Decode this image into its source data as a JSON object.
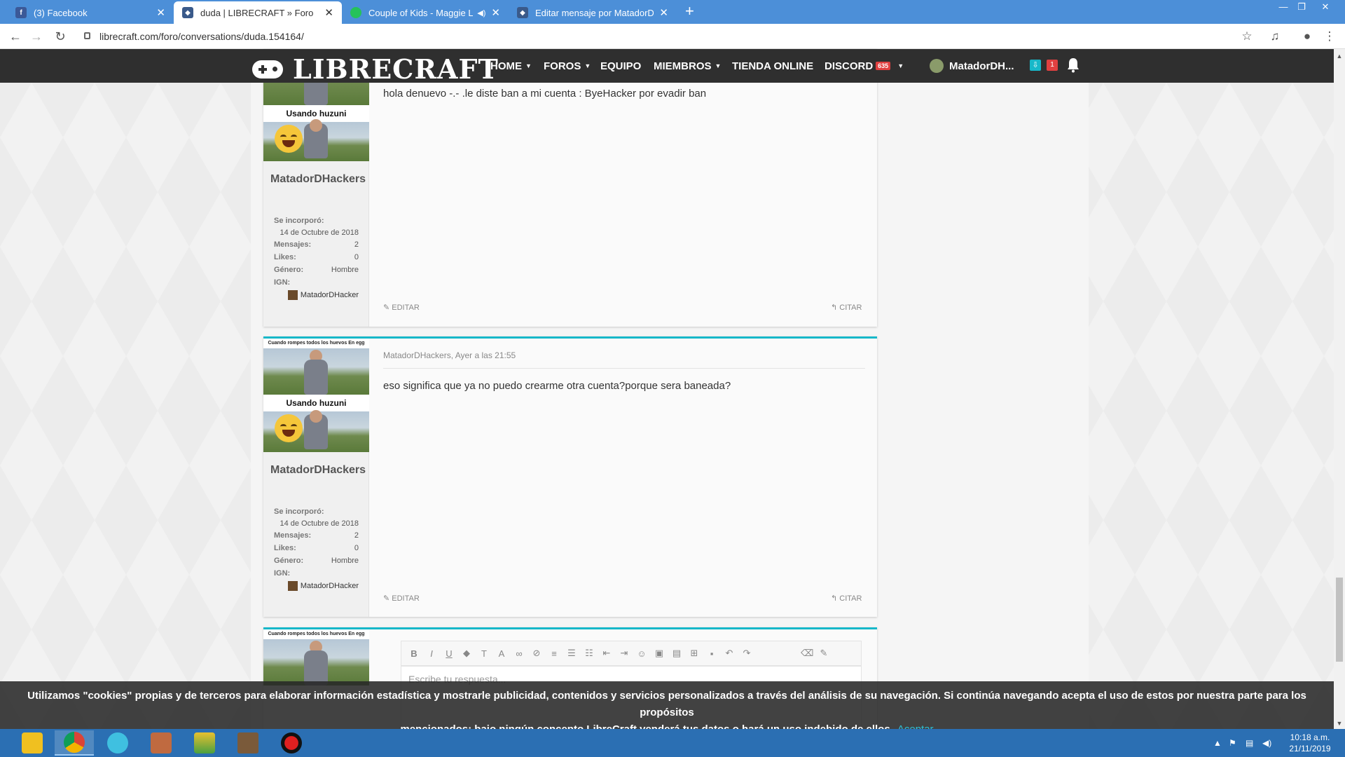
{
  "browser": {
    "tabs": [
      {
        "title": "(3) Facebook",
        "favicon": "facebook-icon",
        "active": false
      },
      {
        "title": "duda | LIBRECRAFT » Foro",
        "favicon": "librecraft-icon",
        "active": true
      },
      {
        "title": "Couple of Kids - Maggie Lind",
        "favicon": "music-icon",
        "active": false,
        "audio": true
      },
      {
        "title": "Editar mensaje por MatadorDHa",
        "favicon": "librecraft-icon",
        "active": false
      }
    ],
    "url": "librecraft.com/foro/conversations/duda.154164/"
  },
  "site": {
    "logo_text": "LIBRECRAFT",
    "nav": {
      "home": "HOME",
      "foros": "FOROS",
      "equipo": "EQUIPO",
      "miembros": "MIEMBROS",
      "tienda": "TIENDA ONLINE",
      "discord": "DISCORD",
      "discord_count": "635"
    },
    "user": {
      "name": "MatadorDH...",
      "alerts": "1"
    }
  },
  "posts": [
    {
      "avatar_caption_top": "Usando huzuni",
      "username": "MatadorDHackers",
      "joined_label": "Se incorporó:",
      "joined": "14 de Octubre de 2018",
      "messages_label": "Mensajes:",
      "messages": "2",
      "likes_label": "Likes:",
      "likes": "0",
      "gender_label": "Género:",
      "gender": "Hombre",
      "ign_label": "IGN:",
      "ign": "MatadorDHacker",
      "body": "hola denuevo -.- .le diste ban a mi cuenta : ByeHacker por evadir ban",
      "edit": "EDITAR",
      "quote": "CITAR"
    },
    {
      "avatar_caption_top": "Cuando rompes todos los huevos En egg wars",
      "avatar_caption_mid": "Usando huzuni",
      "username": "MatadorDHackers",
      "meta": "MatadorDHackers, Ayer a las 21:55",
      "joined_label": "Se incorporó:",
      "joined": "14 de Octubre de 2018",
      "messages_label": "Mensajes:",
      "messages": "2",
      "likes_label": "Likes:",
      "likes": "0",
      "gender_label": "Género:",
      "gender": "Hombre",
      "ign_label": "IGN:",
      "ign": "MatadorDHacker",
      "body": "eso significa que ya no puedo crearme otra cuenta?porque sera baneada?",
      "edit": "EDITAR",
      "quote": "CITAR"
    }
  ],
  "reply": {
    "avatar_caption_top": "Cuando rompes todos los huevos En egg wars",
    "placeholder": "Escribe tu respuesta..."
  },
  "cookie": {
    "text_line1": "Utilizamos \"cookies\" propias y de terceros para elaborar información estadística y mostrarle publicidad, contenidos y servicios personalizados a través del análisis de su navegación. Si continúa navegando acepta el uso de estos por nuestra parte para los propósitos",
    "text_line2": "mencionados; bajo ningún concepto LibreCraft venderá tus datos o hará un uso indebido de ellos.",
    "accept": "Aceptar"
  },
  "taskbar": {
    "time": "10:18 a.m.",
    "date": "21/11/2019"
  },
  "colors": {
    "accent": "#17b8c9",
    "nav_bg": "#2f2f2f",
    "tabbar_bg": "#4c8fd8",
    "taskbar_bg": "#2b6fb3"
  }
}
